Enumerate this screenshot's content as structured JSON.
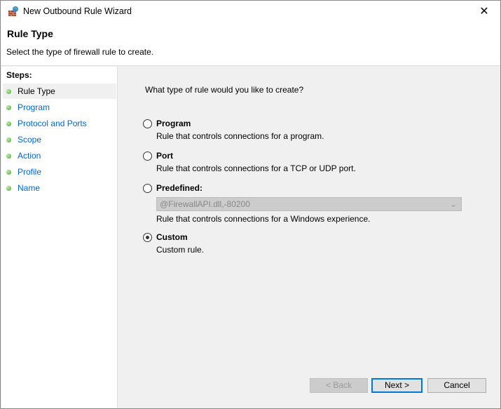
{
  "window": {
    "title": "New Outbound Rule Wizard",
    "close": "✕"
  },
  "header": {
    "title": "Rule Type",
    "subtitle": "Select the type of firewall rule to create."
  },
  "steps": {
    "heading": "Steps:",
    "items": [
      "Rule Type",
      "Program",
      "Protocol and Ports",
      "Scope",
      "Action",
      "Profile",
      "Name"
    ]
  },
  "main": {
    "question": "What type of rule would you like to create?",
    "options": [
      {
        "label": "Program",
        "desc": "Rule that controls connections for a program."
      },
      {
        "label": "Port",
        "desc": "Rule that controls connections for a TCP or UDP port."
      },
      {
        "label": "Predefined:",
        "desc": "Rule that controls connections for a Windows experience."
      },
      {
        "label": "Custom",
        "desc": "Custom rule."
      }
    ],
    "selected": "Custom",
    "predefined_value": "@FirewallAPI.dll,-80200"
  },
  "buttons": {
    "back": "< Back",
    "next": "Next >",
    "cancel": "Cancel"
  }
}
